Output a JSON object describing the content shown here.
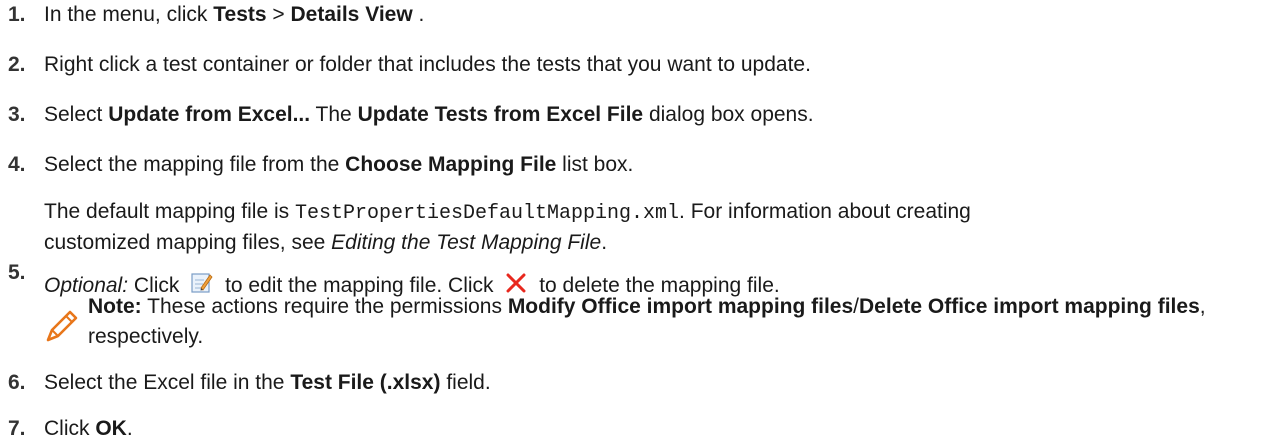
{
  "steps": [
    {
      "num": "1.",
      "pre": "In the menu, click ",
      "b1": "Tests",
      "mid": " > ",
      "b2": "Details View",
      "post": " ."
    },
    {
      "num": "2.",
      "text": "Right click a test container or folder that includes the tests that you want to update."
    },
    {
      "num": "3.",
      "pre": "Select ",
      "b1": "Update from Excel...",
      "mid": " The ",
      "b2": "Update Tests from Excel File",
      "post": " dialog box opens."
    },
    {
      "num": "4.",
      "pre": "Select the mapping file from the ",
      "b1": "Choose Mapping File",
      "post": " list box.",
      "sub_pre": "The default mapping file is ",
      "sub_code": "TestPropertiesDefaultMapping.xml",
      "sub_mid": ". For information about creating",
      "sub_line2_pre": "customized mapping files, see ",
      "sub_link": "Editing the Test Mapping File",
      "sub_line2_post": "."
    },
    {
      "num": "5.",
      "opt": "Optional:",
      "pre": " Click ",
      "mid": " to edit the mapping file. Click ",
      "post": " to delete the mapping file.",
      "edit_icon": "edit-icon",
      "delete_icon": "delete-icon"
    },
    {
      "num": "6.",
      "pre": "Select the Excel file in the ",
      "b1": "Test File (.xlsx)",
      "post": " field."
    },
    {
      "num": "7.",
      "pre": "Click ",
      "b1": "OK",
      "post": "."
    }
  ],
  "note": {
    "label": "Note:",
    "pre": " These actions require the permissions ",
    "b1": "Modify Office import mapping files",
    "sep": "/",
    "b2": "Delete Office import mapping files",
    "post": ", respectively.",
    "icon": "pencil-icon"
  },
  "colors": {
    "text": "#1a1a1a",
    "delete_red": "#e8281e",
    "pencil_orange": "#e8761a"
  }
}
